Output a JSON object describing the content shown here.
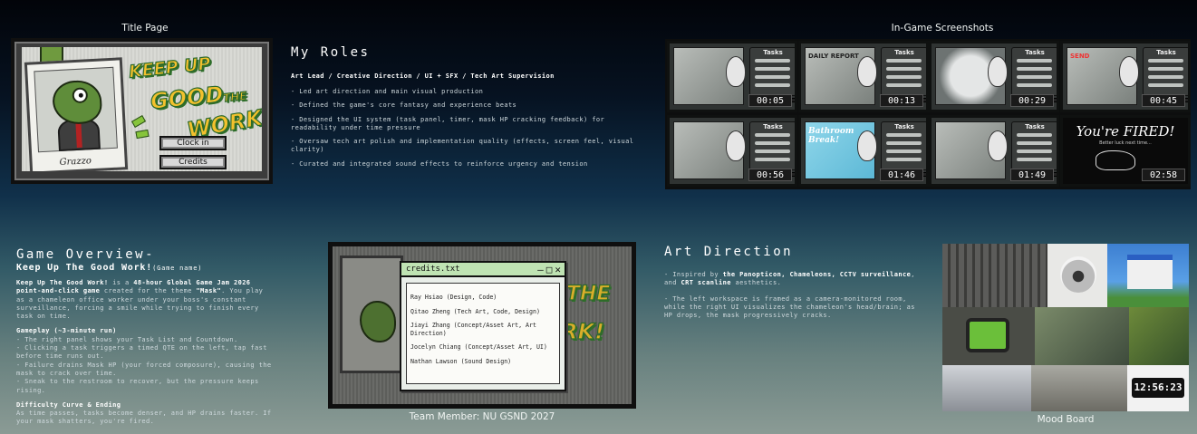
{
  "title_page": {
    "caption": "Title Page",
    "logo_lines": [
      "KEEP UP",
      "THE",
      "GOOD",
      "WORK!"
    ],
    "polaroid_label": "Grazzo",
    "buttons": {
      "clock_in": "Clock in",
      "credits": "Credits"
    }
  },
  "roles": {
    "heading": "My Roles",
    "subtitle": "Art Lead / Creative Direction / UI + SFX / Tech Art Supervision",
    "items": [
      "- Led art direction and main visual production",
      "- Defined the game's core fantasy and experience beats",
      "- Designed the UI system (task panel, timer, mask HP cracking feedback) for readability under time pressure",
      "- Oversaw tech art polish and implementation quality (effects, screen feel, visual clarity)",
      "- Curated and integrated sound effects to reinforce urgency and tension"
    ]
  },
  "screenshots": {
    "caption": "In-Game Screenshots",
    "panel_title": "Tasks",
    "items": [
      {
        "time": "00:05",
        "hp": 0.78,
        "hp_color": "#3fb33b"
      },
      {
        "time": "00:13",
        "hp": 0.8,
        "hp_color": "#3fb33b",
        "note": "DAILY REPORT"
      },
      {
        "time": "00:29",
        "hp": 0.78,
        "hp_color": "#3fb33b"
      },
      {
        "time": "00:45",
        "hp": 0.75,
        "hp_color": "#3fb33b",
        "note": "SEND"
      },
      {
        "time": "00:56",
        "hp": 0.45,
        "hp_color": "#d8c52b"
      },
      {
        "time": "01:46",
        "hp": 0.35,
        "hp_color": "#d8c52b",
        "note": "Bathroom Break!"
      },
      {
        "time": "01:49",
        "hp": 0.3,
        "hp_color": "#d63a2d"
      },
      {
        "time": "02:58",
        "fired_title": "You're FIRED!",
        "fired_sub": "Better luck next time..."
      }
    ]
  },
  "overview": {
    "heading": "Game Overview-",
    "game_title": "Keep Up The Good Work!",
    "game_name_note": "(Game name)",
    "intro_bold": "Keep Up The Good Work!",
    "intro_1": " is a ",
    "intro_bold2": "48-hour Global Game Jam 2026 point-and-click game",
    "intro_2": " created for the theme ",
    "intro_bold3": "\"Mask\"",
    "intro_3": ". You play as a chameleon office worker under your boss's constant surveillance, forcing a smile while trying to finish every task on time.",
    "gameplay_heading": "Gameplay (~3-minute run)",
    "gameplay_items": [
      "- The right panel shows your Task List and Countdown.",
      "- Clicking a task triggers a timed QTE on the left, tap fast before time runs out.",
      "- Failure drains Mask HP (your forced composure), causing the mask to crack over time.",
      "- Sneak to the restroom to recover, but the pressure keeps rising."
    ],
    "difficulty_heading": "Difficulty Curve & Ending",
    "difficulty_text": "As time passes, tasks become denser, and HP drains faster. If your mask shatters, you're fired."
  },
  "credits": {
    "window_title": "credits.txt",
    "controls": [
      "—",
      "□",
      "✕"
    ],
    "items": [
      "Ray Hsiao (Design, Code)",
      "Qitao Zheng (Tech Art, Code, Design)",
      "Jiayi Zhang (Concept/Asset Art, Art Direction)",
      "Jocelyn Chiang (Concept/Asset Art, UI)",
      "Nathan Lawson (Sound Design)"
    ],
    "caption": "Team Member: NU GSND 2027"
  },
  "art_direction": {
    "heading": "Art Direction",
    "p1_pre": "- Inspired by ",
    "p1_bold": "the Panopticon, Chameleons, CCTV surveillance",
    "p1_mid": ", and ",
    "p1_bold2": "CRT scanline",
    "p1_post": " aesthetics.",
    "p2": "- The left workspace is framed as a camera-monitored room, while the right UI visualizes the chameleon's head/brain; as HP drops, the mask progressively cracks."
  },
  "mood_board": {
    "caption": "Mood Board",
    "clock_text": "12:56:23"
  }
}
